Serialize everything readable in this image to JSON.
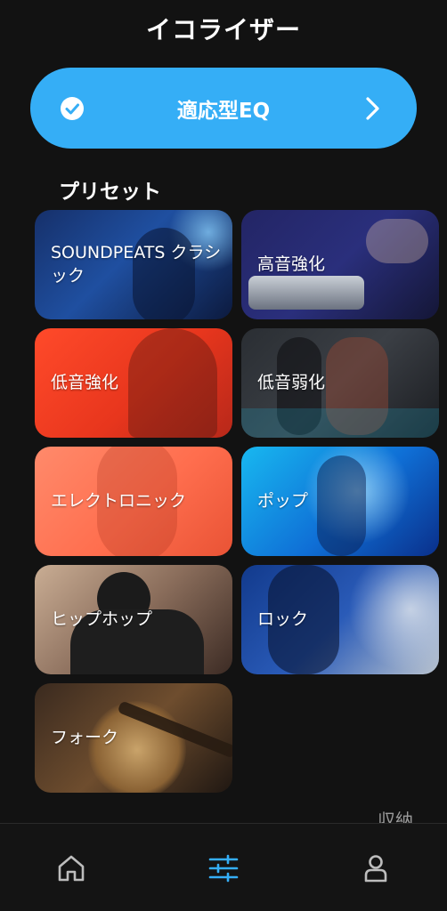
{
  "header": {
    "title": "イコライザー"
  },
  "adaptive_eq": {
    "label": "適応型EQ",
    "selected": true,
    "icon": "check-icon",
    "chevron_icon": "chevron-right-icon",
    "accent_color": "#35aef6"
  },
  "presets": {
    "title": "プリセット",
    "items": [
      {
        "label": "SOUNDPEATS クラシック"
      },
      {
        "label": "高音強化"
      },
      {
        "label": "低音強化"
      },
      {
        "label": "低音弱化"
      },
      {
        "label": "エレクトロニック"
      },
      {
        "label": "ポップ"
      },
      {
        "label": "ヒップホップ"
      },
      {
        "label": "ロック"
      },
      {
        "label": "フォーク"
      }
    ]
  },
  "collapse_label": "収納",
  "bottom_nav": {
    "items": [
      {
        "icon": "home-icon",
        "active": false
      },
      {
        "icon": "equalizer-icon",
        "active": true
      },
      {
        "icon": "profile-icon",
        "active": false
      }
    ],
    "active_color": "#35aef6",
    "inactive_color": "#bdbdbd"
  }
}
